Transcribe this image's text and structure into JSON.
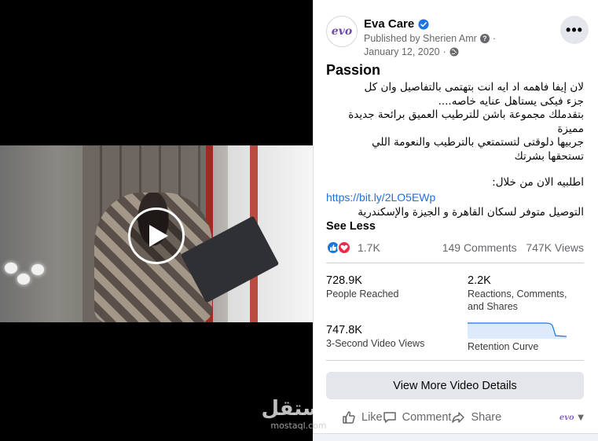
{
  "page": {
    "name": "Eva Care",
    "avatar_text": "evo",
    "published_by": "Published by Sherien Amr",
    "date": "January 12, 2020",
    "separator": "·",
    "more_label": "•••"
  },
  "post": {
    "title": "Passion",
    "body_lines": [
      "لان إيفا فاهمه اد ايه انت بتهتمى بالتفاصيل وان كل",
      "جزء فيكى يستاهل عنايه خاصه....",
      "بتقدملك مجموعة باشن للترطيب العميق برائحة جديدة",
      "مميزة",
      "جربيها دلوقتى لتستمتعي بالترطيب والنعومة اللي",
      "تستحقها بشرتك"
    ],
    "cta": "اطلبيه الان من خلال:",
    "link": "https://bit.ly/2LO5EWp",
    "delivery": "التوصيل متوفر لسكان القاهرة و الجيزة والإسكندرية",
    "see_less": "See Less"
  },
  "engagement": {
    "reactions_count": "1.7K",
    "comments": "149 Comments",
    "views": "747K Views"
  },
  "stats": {
    "people_reached_value": "728.9K",
    "people_reached_label": "People Reached",
    "reactions_value": "2.2K",
    "reactions_label": "Reactions, Comments, and Shares",
    "video_views_value": "747.8K",
    "video_views_label": "3-Second Video Views",
    "retention_label": "Retention Curve"
  },
  "buttons": {
    "details": "View More Video Details",
    "like": "Like",
    "comment": "Comment",
    "share": "Share"
  },
  "watermark": {
    "main": "مستقل",
    "sub": "mostaql.com"
  },
  "colors": {
    "link": "#216fdb",
    "verified": "#1b74e4",
    "like_reaction": "#1b74e4",
    "love_reaction": "#f0284a",
    "button_bg": "#e4e6eb",
    "brand_purple": "#8e6ac7"
  },
  "icons": {
    "verified": "verified-badge-icon",
    "info": "info-icon",
    "globe": "globe-icon",
    "play": "play-icon",
    "like": "thumbs-up-icon",
    "comment": "comment-icon",
    "share": "share-arrow-icon"
  }
}
